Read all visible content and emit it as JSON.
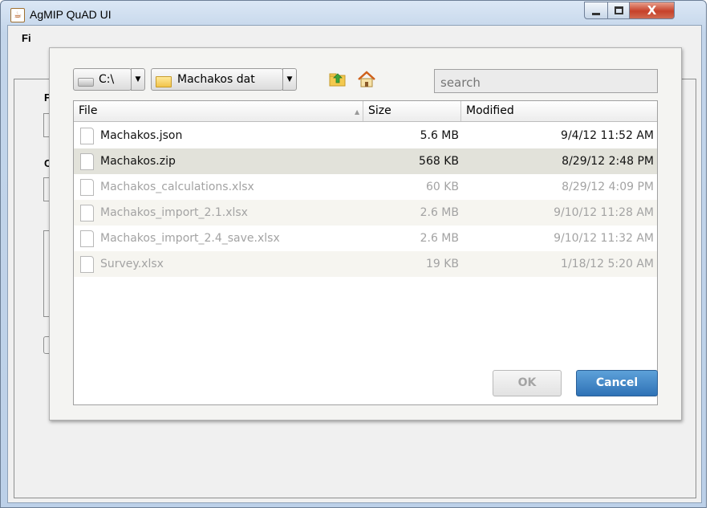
{
  "window": {
    "title": "AgMIP QuAD UI",
    "menu_partial": "Fi",
    "controls": {
      "close_glyph": "X"
    }
  },
  "background_fragments": {
    "label_1": "F",
    "label_2": "C"
  },
  "dialog": {
    "drive_combo": {
      "value": "C:\\",
      "icon": "drive-icon"
    },
    "folder_combo": {
      "value": "Machakos dat",
      "icon": "folder-icon"
    },
    "toolbar_icons": [
      "up-folder-icon",
      "home-icon"
    ],
    "search": {
      "placeholder": "search"
    },
    "table": {
      "columns": [
        "File",
        "Size",
        "Modified"
      ],
      "rows": [
        {
          "name": "Machakos.json",
          "size": "5.6 MB",
          "modified": "9/4/12 11:52 AM",
          "enabled": true,
          "selected": false
        },
        {
          "name": "Machakos.zip",
          "size": "568 KB",
          "modified": "8/29/12 2:48 PM",
          "enabled": true,
          "selected": true
        },
        {
          "name": "Machakos_calculations.xlsx",
          "size": "60 KB",
          "modified": "8/29/12 4:09 PM",
          "enabled": false,
          "selected": false
        },
        {
          "name": "Machakos_import_2.1.xlsx",
          "size": "2.6 MB",
          "modified": "9/10/12 11:28 AM",
          "enabled": false,
          "selected": false
        },
        {
          "name": "Machakos_import_2.4_save.xlsx",
          "size": "2.6 MB",
          "modified": "9/10/12 11:32 AM",
          "enabled": false,
          "selected": false
        },
        {
          "name": "Survey.xlsx",
          "size": "19 KB",
          "modified": "1/18/12 5:20 AM",
          "enabled": false,
          "selected": false
        }
      ]
    },
    "buttons": {
      "ok": "OK",
      "cancel": "Cancel"
    }
  },
  "colors": {
    "accent": "#3a7fc1",
    "selected_row": "#e2e2da",
    "disabled_text": "#a3a3a3"
  }
}
